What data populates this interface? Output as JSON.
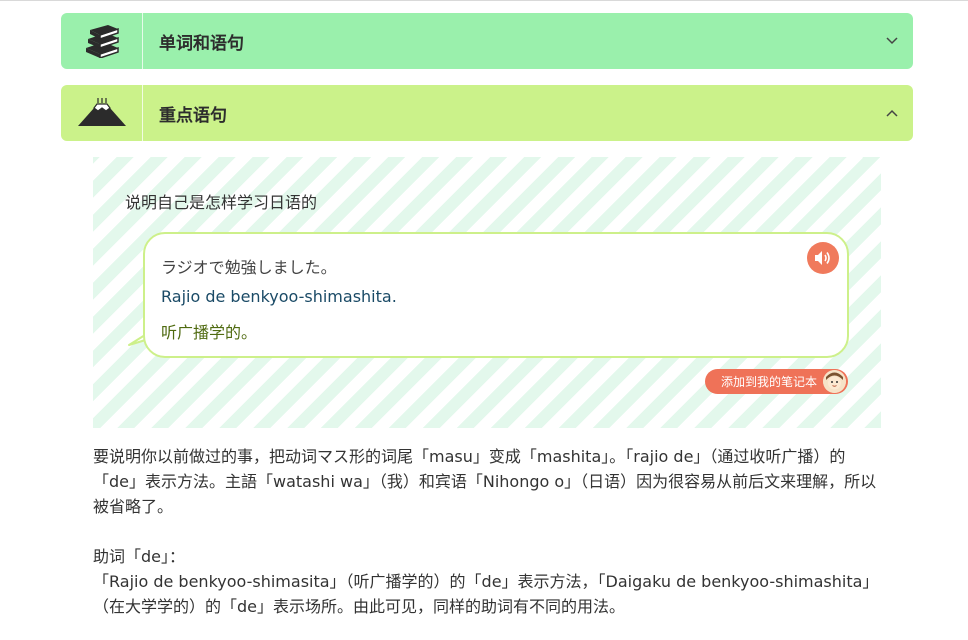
{
  "sections": {
    "words": {
      "title": "单词和语句",
      "icon": "books-icon",
      "state": "collapsed",
      "color": "#9af0ac"
    },
    "key": {
      "title": "重点语句",
      "icon": "mount-fuji-icon",
      "state": "expanded",
      "color": "#cbf28a"
    }
  },
  "sentence": {
    "subtitle": "说明自己是怎样学习日语的",
    "japanese": "ラジオで勉強しました。",
    "romaji": "Rajio de benkyoo-shimashita.",
    "chinese": "听广播学的。",
    "audio_icon": "speaker-icon",
    "add_note_label": "添加到我的笔记本",
    "mascot_icon": "mascot-avatar-icon"
  },
  "explanation": {
    "paragraph1": "要说明你以前做过的事，把动词マス形的词尾「masu」变成「mashita」。「rajio de」（通过收听广播）的「de」表示方法。主語「watashi wa」（我）和宾语「Nihongo o」（日语）因为很容易从前后文来理解，所以被省略了。",
    "particle_heading": "助词「de」：",
    "paragraph2": "「Rajio de benkyoo-shimasita」（听广播学的）的「de」表示方法，「Daigaku de benkyoo-shimashita」（在大学学的）的「de」表示场所。由此可见，同样的助词有不同的用法。"
  },
  "colors": {
    "accent_coral": "#ef7258",
    "stripe_green": "#e3f8ec",
    "bubble_border": "#cdf08a"
  }
}
